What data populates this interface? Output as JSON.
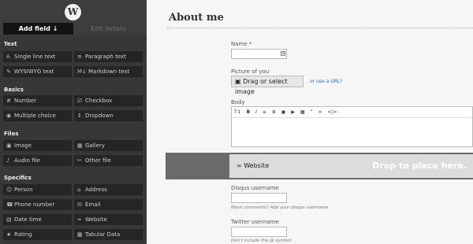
{
  "app": {
    "logo_letter": "W"
  },
  "tabs": [
    {
      "label": "Add field ↓",
      "active": true
    },
    {
      "label": "Edit details",
      "active": false
    }
  ],
  "sidebar": {
    "sections": [
      {
        "title": "Text",
        "fields": [
          {
            "label": "Single line text",
            "icon": "A"
          },
          {
            "label": "Paragraph text",
            "icon": "≡"
          },
          {
            "label": "WYSIWYG text",
            "icon": "✎"
          },
          {
            "label": "Markdown text",
            "icon": "M↓"
          }
        ]
      },
      {
        "title": "Basics",
        "fields": [
          {
            "label": "Number",
            "icon": "#"
          },
          {
            "label": "Checkbox",
            "icon": "☑"
          },
          {
            "label": "Multiple choice",
            "icon": "◉"
          },
          {
            "label": "Dropdown",
            "icon": "↕"
          }
        ]
      },
      {
        "title": "Files",
        "fields": [
          {
            "label": "Image",
            "icon": "▣"
          },
          {
            "label": "Gallery",
            "icon": "▦"
          },
          {
            "label": "Audio file",
            "icon": "♪"
          },
          {
            "label": "Other file",
            "icon": "✂"
          }
        ]
      },
      {
        "title": "Specifics",
        "fields": [
          {
            "label": "Person",
            "icon": "☺"
          },
          {
            "label": "Address",
            "icon": "⌂"
          },
          {
            "label": "Phone number",
            "icon": "☎"
          },
          {
            "label": "Email",
            "icon": "✉"
          },
          {
            "label": "Date time",
            "icon": "▤"
          },
          {
            "label": "Website",
            "icon": "∞"
          },
          {
            "label": "Rating",
            "icon": "★"
          },
          {
            "label": "Tabular Data",
            "icon": "▦"
          }
        ]
      }
    ]
  },
  "form": {
    "title": "About me",
    "name": {
      "label": "Name",
      "required_mark": "*",
      "value": ""
    },
    "picture": {
      "label": "Picture of you",
      "button": "Drag or select image",
      "link": "or use a URL?"
    },
    "body": {
      "label": "Body",
      "toolbar": [
        "T↕",
        "B",
        "I",
        "≡",
        "≣",
        "▣",
        "▶",
        "▦",
        "”",
        "∞",
        "</>"
      ]
    },
    "drop": {
      "field_label": "Website",
      "field_icon": "∞",
      "message": "Drop to place here."
    },
    "disqus": {
      "label": "Disqus username",
      "hint": "Want comments? Add your disqus username."
    },
    "twitter": {
      "label": "Twitter username",
      "hint": "Don't include the @ symbol."
    }
  }
}
